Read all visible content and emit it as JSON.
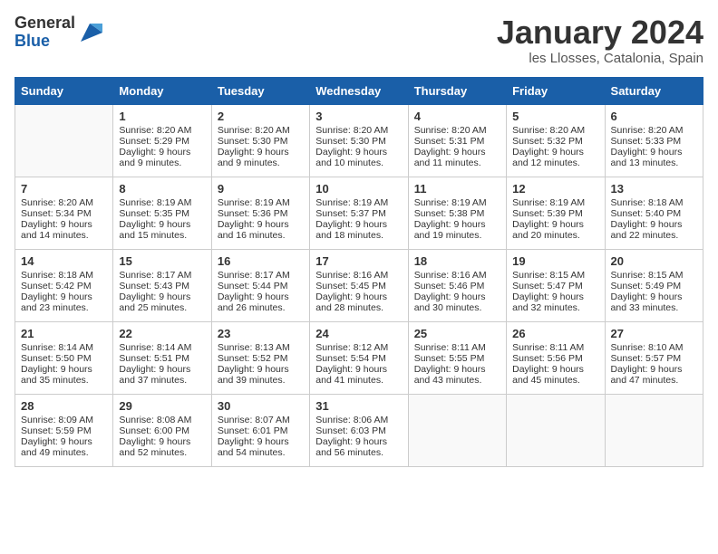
{
  "header": {
    "logo_general": "General",
    "logo_blue": "Blue",
    "month_title": "January 2024",
    "location": "les Llosses, Catalonia, Spain"
  },
  "calendar": {
    "days_of_week": [
      "Sunday",
      "Monday",
      "Tuesday",
      "Wednesday",
      "Thursday",
      "Friday",
      "Saturday"
    ],
    "weeks": [
      [
        {
          "day": "",
          "sunrise": "",
          "sunset": "",
          "daylight": ""
        },
        {
          "day": "1",
          "sunrise": "Sunrise: 8:20 AM",
          "sunset": "Sunset: 5:29 PM",
          "daylight": "Daylight: 9 hours and 9 minutes."
        },
        {
          "day": "2",
          "sunrise": "Sunrise: 8:20 AM",
          "sunset": "Sunset: 5:30 PM",
          "daylight": "Daylight: 9 hours and 9 minutes."
        },
        {
          "day": "3",
          "sunrise": "Sunrise: 8:20 AM",
          "sunset": "Sunset: 5:30 PM",
          "daylight": "Daylight: 9 hours and 10 minutes."
        },
        {
          "day": "4",
          "sunrise": "Sunrise: 8:20 AM",
          "sunset": "Sunset: 5:31 PM",
          "daylight": "Daylight: 9 hours and 11 minutes."
        },
        {
          "day": "5",
          "sunrise": "Sunrise: 8:20 AM",
          "sunset": "Sunset: 5:32 PM",
          "daylight": "Daylight: 9 hours and 12 minutes."
        },
        {
          "day": "6",
          "sunrise": "Sunrise: 8:20 AM",
          "sunset": "Sunset: 5:33 PM",
          "daylight": "Daylight: 9 hours and 13 minutes."
        }
      ],
      [
        {
          "day": "7",
          "sunrise": "Sunrise: 8:20 AM",
          "sunset": "Sunset: 5:34 PM",
          "daylight": "Daylight: 9 hours and 14 minutes."
        },
        {
          "day": "8",
          "sunrise": "Sunrise: 8:19 AM",
          "sunset": "Sunset: 5:35 PM",
          "daylight": "Daylight: 9 hours and 15 minutes."
        },
        {
          "day": "9",
          "sunrise": "Sunrise: 8:19 AM",
          "sunset": "Sunset: 5:36 PM",
          "daylight": "Daylight: 9 hours and 16 minutes."
        },
        {
          "day": "10",
          "sunrise": "Sunrise: 8:19 AM",
          "sunset": "Sunset: 5:37 PM",
          "daylight": "Daylight: 9 hours and 18 minutes."
        },
        {
          "day": "11",
          "sunrise": "Sunrise: 8:19 AM",
          "sunset": "Sunset: 5:38 PM",
          "daylight": "Daylight: 9 hours and 19 minutes."
        },
        {
          "day": "12",
          "sunrise": "Sunrise: 8:19 AM",
          "sunset": "Sunset: 5:39 PM",
          "daylight": "Daylight: 9 hours and 20 minutes."
        },
        {
          "day": "13",
          "sunrise": "Sunrise: 8:18 AM",
          "sunset": "Sunset: 5:40 PM",
          "daylight": "Daylight: 9 hours and 22 minutes."
        }
      ],
      [
        {
          "day": "14",
          "sunrise": "Sunrise: 8:18 AM",
          "sunset": "Sunset: 5:42 PM",
          "daylight": "Daylight: 9 hours and 23 minutes."
        },
        {
          "day": "15",
          "sunrise": "Sunrise: 8:17 AM",
          "sunset": "Sunset: 5:43 PM",
          "daylight": "Daylight: 9 hours and 25 minutes."
        },
        {
          "day": "16",
          "sunrise": "Sunrise: 8:17 AM",
          "sunset": "Sunset: 5:44 PM",
          "daylight": "Daylight: 9 hours and 26 minutes."
        },
        {
          "day": "17",
          "sunrise": "Sunrise: 8:16 AM",
          "sunset": "Sunset: 5:45 PM",
          "daylight": "Daylight: 9 hours and 28 minutes."
        },
        {
          "day": "18",
          "sunrise": "Sunrise: 8:16 AM",
          "sunset": "Sunset: 5:46 PM",
          "daylight": "Daylight: 9 hours and 30 minutes."
        },
        {
          "day": "19",
          "sunrise": "Sunrise: 8:15 AM",
          "sunset": "Sunset: 5:47 PM",
          "daylight": "Daylight: 9 hours and 32 minutes."
        },
        {
          "day": "20",
          "sunrise": "Sunrise: 8:15 AM",
          "sunset": "Sunset: 5:49 PM",
          "daylight": "Daylight: 9 hours and 33 minutes."
        }
      ],
      [
        {
          "day": "21",
          "sunrise": "Sunrise: 8:14 AM",
          "sunset": "Sunset: 5:50 PM",
          "daylight": "Daylight: 9 hours and 35 minutes."
        },
        {
          "day": "22",
          "sunrise": "Sunrise: 8:14 AM",
          "sunset": "Sunset: 5:51 PM",
          "daylight": "Daylight: 9 hours and 37 minutes."
        },
        {
          "day": "23",
          "sunrise": "Sunrise: 8:13 AM",
          "sunset": "Sunset: 5:52 PM",
          "daylight": "Daylight: 9 hours and 39 minutes."
        },
        {
          "day": "24",
          "sunrise": "Sunrise: 8:12 AM",
          "sunset": "Sunset: 5:54 PM",
          "daylight": "Daylight: 9 hours and 41 minutes."
        },
        {
          "day": "25",
          "sunrise": "Sunrise: 8:11 AM",
          "sunset": "Sunset: 5:55 PM",
          "daylight": "Daylight: 9 hours and 43 minutes."
        },
        {
          "day": "26",
          "sunrise": "Sunrise: 8:11 AM",
          "sunset": "Sunset: 5:56 PM",
          "daylight": "Daylight: 9 hours and 45 minutes."
        },
        {
          "day": "27",
          "sunrise": "Sunrise: 8:10 AM",
          "sunset": "Sunset: 5:57 PM",
          "daylight": "Daylight: 9 hours and 47 minutes."
        }
      ],
      [
        {
          "day": "28",
          "sunrise": "Sunrise: 8:09 AM",
          "sunset": "Sunset: 5:59 PM",
          "daylight": "Daylight: 9 hours and 49 minutes."
        },
        {
          "day": "29",
          "sunrise": "Sunrise: 8:08 AM",
          "sunset": "Sunset: 6:00 PM",
          "daylight": "Daylight: 9 hours and 52 minutes."
        },
        {
          "day": "30",
          "sunrise": "Sunrise: 8:07 AM",
          "sunset": "Sunset: 6:01 PM",
          "daylight": "Daylight: 9 hours and 54 minutes."
        },
        {
          "day": "31",
          "sunrise": "Sunrise: 8:06 AM",
          "sunset": "Sunset: 6:03 PM",
          "daylight": "Daylight: 9 hours and 56 minutes."
        },
        {
          "day": "",
          "sunrise": "",
          "sunset": "",
          "daylight": ""
        },
        {
          "day": "",
          "sunrise": "",
          "sunset": "",
          "daylight": ""
        },
        {
          "day": "",
          "sunrise": "",
          "sunset": "",
          "daylight": ""
        }
      ]
    ]
  }
}
